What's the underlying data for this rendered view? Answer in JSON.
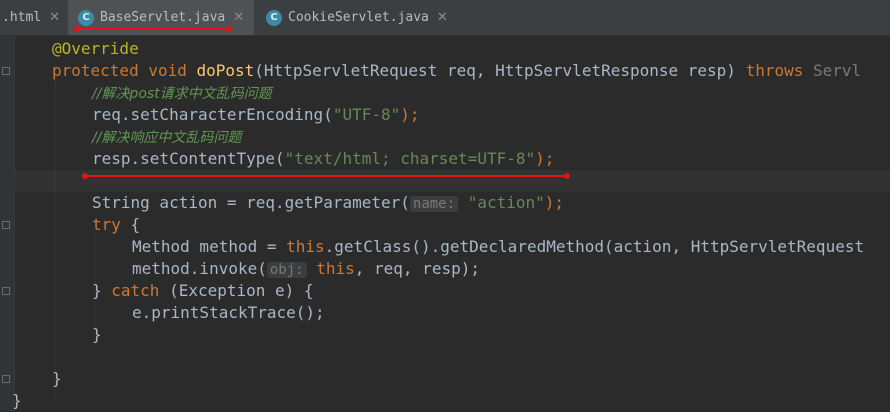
{
  "tabs": [
    {
      "label": ".html",
      "close": "✕"
    },
    {
      "label": "BaseServlet.java",
      "icon": "C",
      "close": "✕",
      "active": true
    },
    {
      "label": "CookieServlet.java",
      "icon": "C",
      "close": "✕"
    }
  ],
  "code": {
    "l1": {
      "ann": "@Override"
    },
    "l2": {
      "kw1": "protected",
      "kw2": " void ",
      "fn": "doPost",
      "t1": "(HttpServletRequest req, HttpServletResponse resp) ",
      "kw3": "throws",
      "t2": " Servl"
    },
    "l3": {
      "cmt": "//解决post请求中文乱码问题"
    },
    "l4": {
      "t1": "req.setCharacterEncoding(",
      "str": "\"UTF-8\"",
      "t2": ");"
    },
    "l5": {
      "cmt": "//解决响应中文乱码问题"
    },
    "l6": {
      "t1": "resp.setContentType(",
      "str": "\"text/html; charset=UTF-8\"",
      "t2": ");"
    },
    "l8": {
      "t1": "String action = req.getParameter(",
      "hint": "name:",
      "str": "\"action\"",
      "t2": ");"
    },
    "l9": {
      "kw": "try",
      "t1": " {"
    },
    "l10": {
      "t1": "Method method = ",
      "kw": "this",
      "t2": ".getClass().getDeclaredMethod(action, HttpServletRequest"
    },
    "l11": {
      "t1": "method.invoke(",
      "hint": "obj:",
      "kw": "this",
      "t2": ", req, resp);"
    },
    "l12": {
      "t1": "} ",
      "kw": "catch",
      "t2": " (Exception e) {"
    },
    "l13": {
      "t1": "e.printStackTrace();"
    },
    "l14": {
      "t1": "}"
    },
    "l16": {
      "t1": "}"
    },
    "l17": {
      "t1": "}"
    }
  },
  "colors": {
    "annotation_red": "#e51515",
    "keyword": "#cc7832",
    "string": "#6a8759",
    "comment": "#629755",
    "method": "#ffc66d"
  }
}
